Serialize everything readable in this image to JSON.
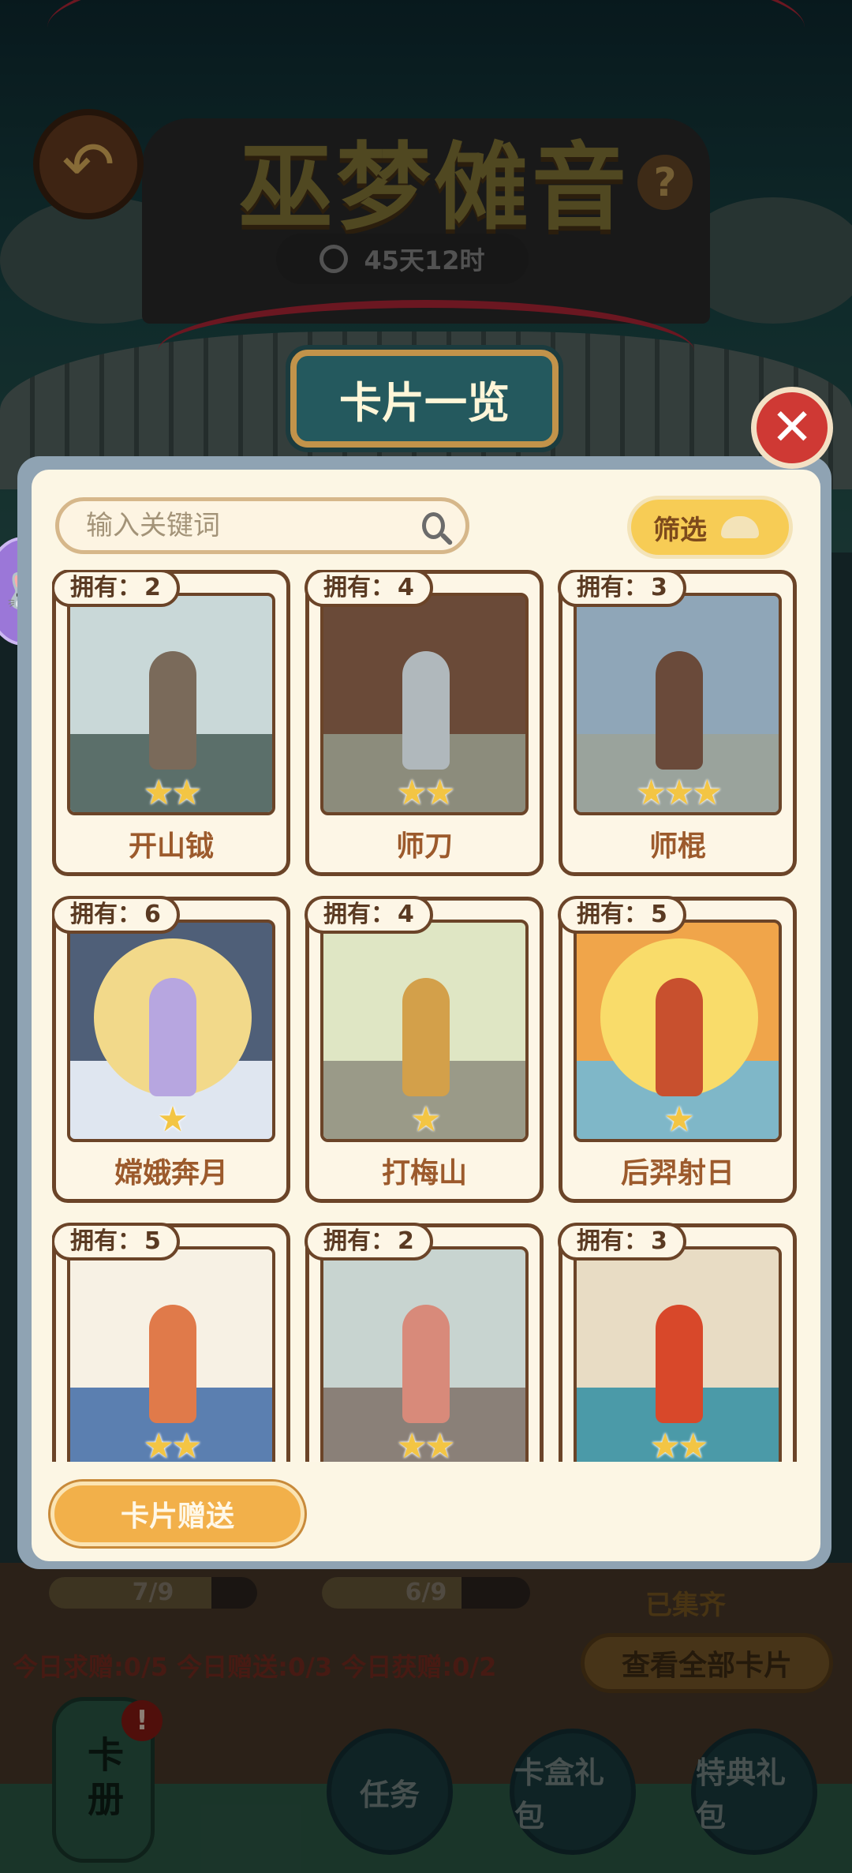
{
  "header": {
    "title": "巫梦傩音",
    "timer": "45天12时",
    "help_label": "?"
  },
  "modal": {
    "title": "卡片一览",
    "close_label": "✕",
    "search_placeholder": "输入关键词",
    "filter_label": "筛选",
    "owned_prefix": "拥有：",
    "gift_button": "卡片赠送"
  },
  "cards": [
    {
      "name": "开山钺",
      "owned": "2",
      "stars": 2,
      "theme": "axe"
    },
    {
      "name": "师刀",
      "owned": "4",
      "stars": 2,
      "theme": "blade"
    },
    {
      "name": "师棍",
      "owned": "3",
      "stars": 3,
      "theme": "staff"
    },
    {
      "name": "嫦娥奔月",
      "owned": "6",
      "stars": 1,
      "theme": "moon"
    },
    {
      "name": "打梅山",
      "owned": "4",
      "stars": 1,
      "theme": "feast"
    },
    {
      "name": "后羿射日",
      "owned": "5",
      "stars": 1,
      "theme": "archer"
    },
    {
      "name": "",
      "owned": "5",
      "stars": 2,
      "theme": "butterfly"
    },
    {
      "name": "",
      "owned": "2",
      "stars": 2,
      "theme": "wall"
    },
    {
      "name": "",
      "owned": "3",
      "stars": 2,
      "theme": "dragon"
    }
  ],
  "hud": {
    "progress_1": {
      "label": "7/9",
      "fraction": 0.78
    },
    "progress_2": {
      "label": "6/9",
      "fraction": 0.67
    },
    "collected_label": "已集齐",
    "daily_stats": "今日求赠:0/5 今日赠送:0/3 今日获赠:0/2",
    "view_all_label": "查看全部卡片",
    "album_label": "卡册",
    "alert_label": "!",
    "buttons": [
      "任务",
      "卡盒礼包",
      "特典礼包"
    ]
  },
  "colors": {
    "panel_bg": "#fcf6e4",
    "card_border": "#6b4428",
    "title_plate": "#24595e",
    "close_red": "#cf3934",
    "gift_orange": "#f2b04a",
    "star_yellow": "#f3c544"
  },
  "icons": {
    "back": "back-arrow-icon",
    "search": "search-icon",
    "filter": "cloud-filter-icon",
    "bunny": "bunny-icon"
  }
}
